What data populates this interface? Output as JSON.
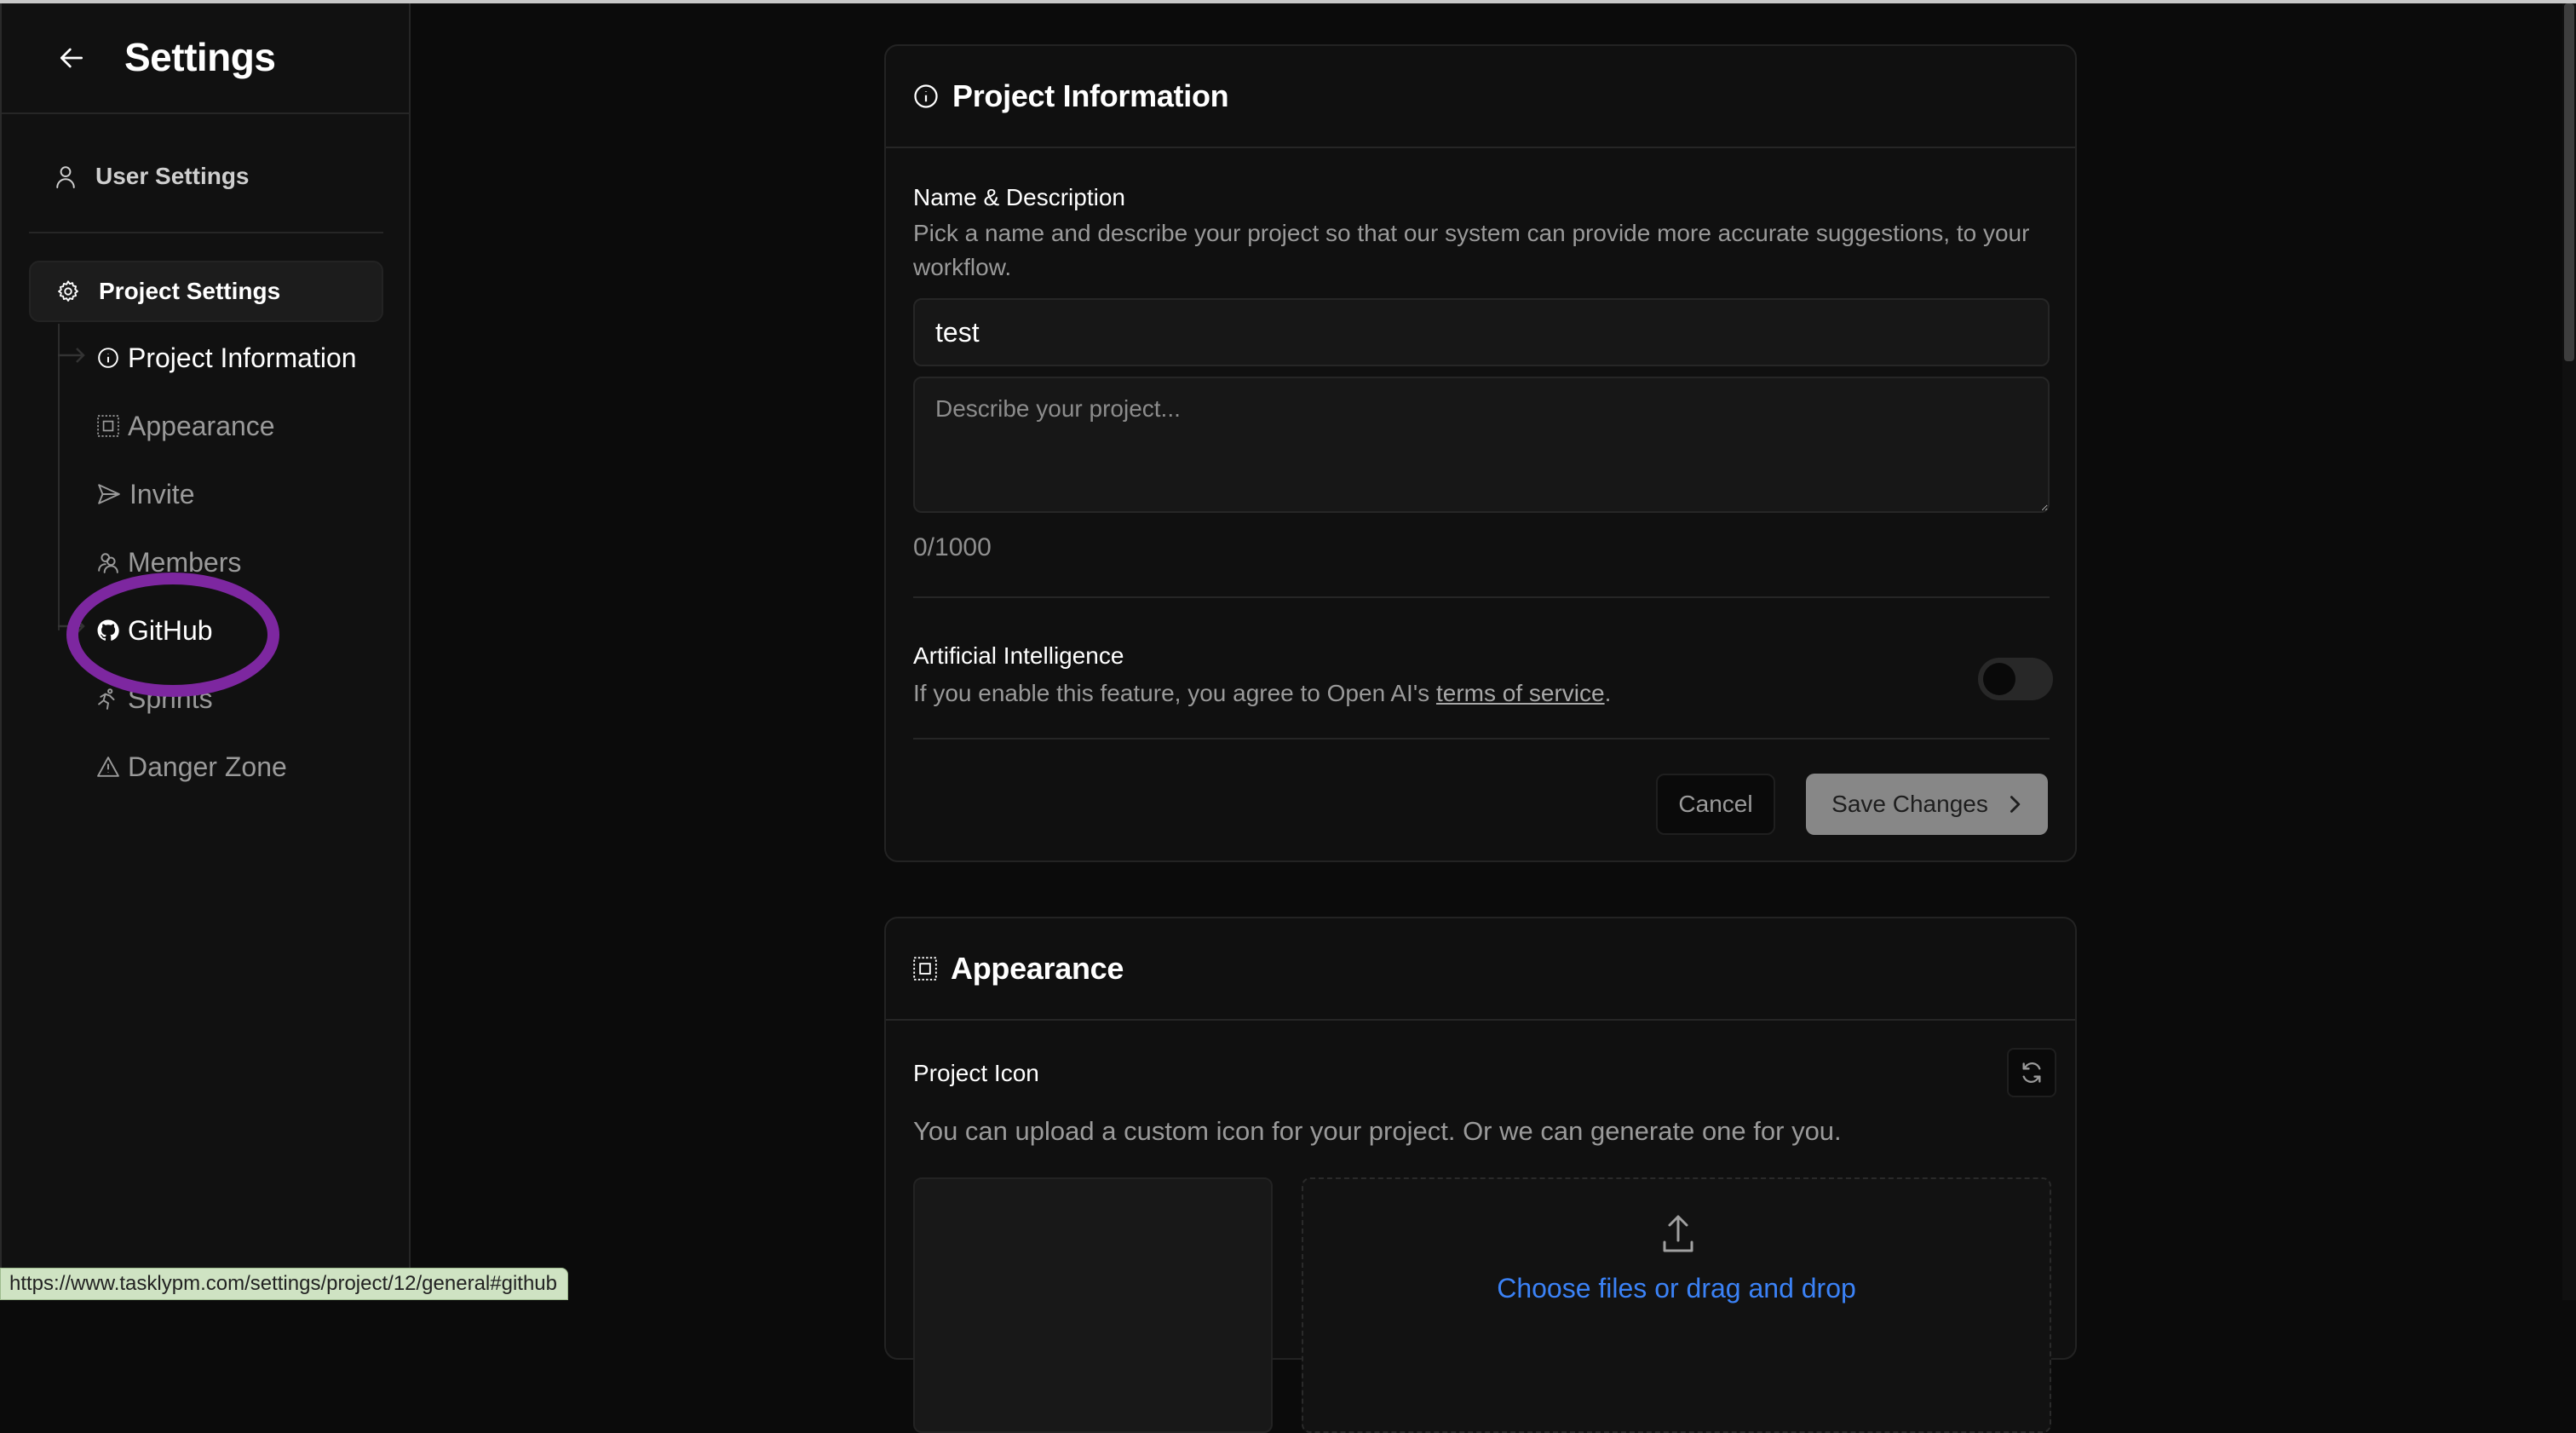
{
  "sidebar": {
    "title": "Settings",
    "back_icon": "arrow-left-icon",
    "user_settings": {
      "label": "User Settings",
      "icon": "user-icon"
    },
    "project_settings": {
      "label": "Project Settings",
      "icon": "gear-icon"
    },
    "sub_items": [
      {
        "label": "Project Information",
        "icon": "info-icon",
        "state": "active"
      },
      {
        "label": "Appearance",
        "icon": "appearance-icon",
        "state": "normal"
      },
      {
        "label": "Invite",
        "icon": "send-icon",
        "state": "normal"
      },
      {
        "label": "Members",
        "icon": "users-icon",
        "state": "normal"
      },
      {
        "label": "GitHub",
        "icon": "github-icon",
        "state": "hovered"
      },
      {
        "label": "Sprints",
        "icon": "running-icon",
        "state": "normal"
      },
      {
        "label": "Danger Zone",
        "icon": "warning-icon",
        "state": "normal"
      }
    ]
  },
  "project_info": {
    "title": "Project Information",
    "name_desc_label": "Name & Description",
    "name_desc_help": "Pick a name and describe your project so that our system can provide more accurate suggestions, to your workflow.",
    "name_value": "test",
    "description_placeholder": "Describe your project...",
    "description_value": "",
    "char_counter": "0/1000",
    "ai_label": "Artificial Intelligence",
    "ai_help_prefix": "If you enable this feature, you agree to Open AI's ",
    "ai_help_link": "terms of service",
    "ai_help_suffix": ".",
    "ai_enabled": false,
    "cancel_label": "Cancel",
    "save_label": "Save Changes"
  },
  "appearance": {
    "title": "Appearance",
    "project_icon_label": "Project Icon",
    "project_icon_help": "You can upload a custom icon for your project. Or we can generate one for you.",
    "upload_label": "Choose files or drag and drop"
  },
  "status_bar": {
    "url": "https://www.tasklypm.com/settings/project/12/general#github"
  },
  "colors": {
    "background": "#0b0b0b",
    "card": "#101010",
    "link_blue": "#3b82f6",
    "annotation_purple": "#7d27a0",
    "save_button": "#878787"
  }
}
